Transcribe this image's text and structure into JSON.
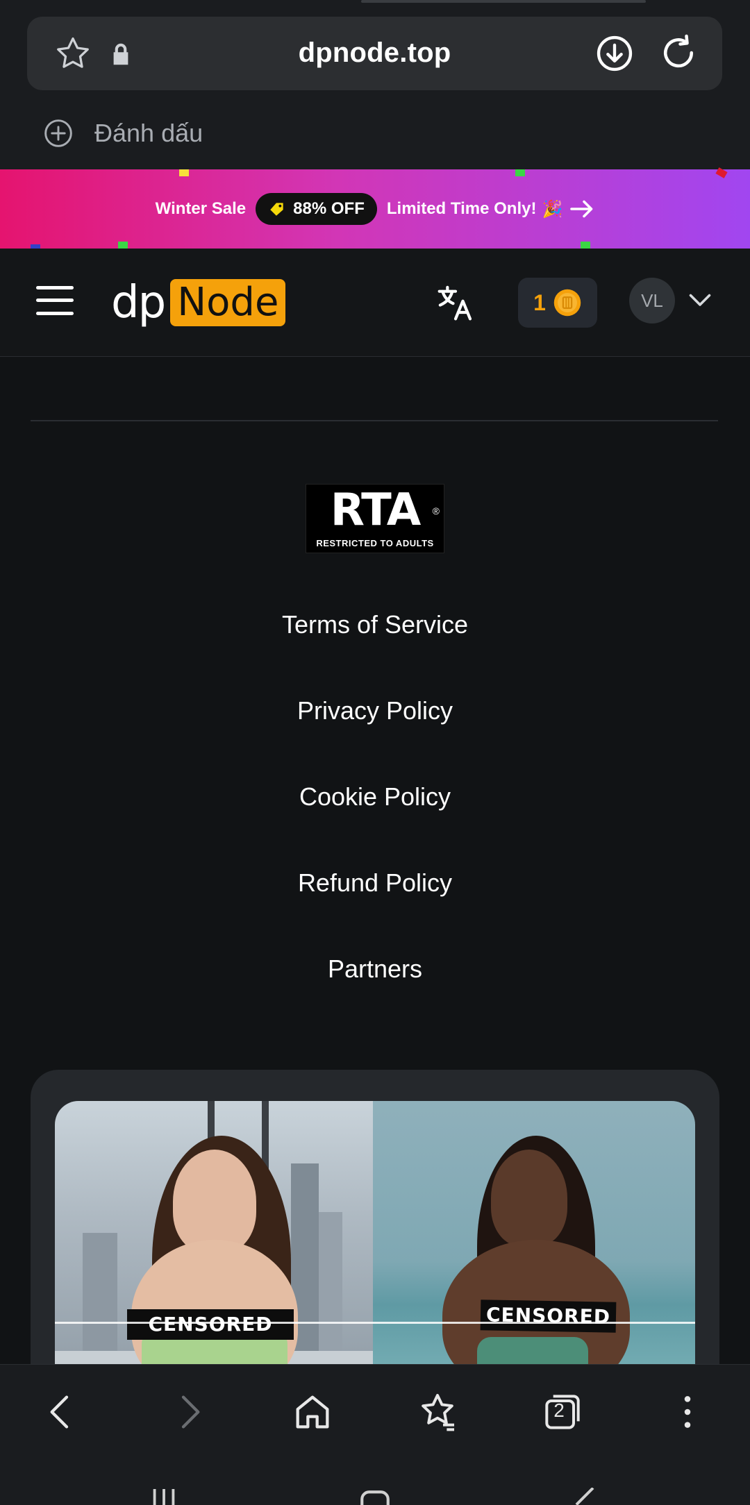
{
  "browser": {
    "url": "dpnode.top",
    "bookmark_label": "Đánh dấu"
  },
  "promo_banner": {
    "sale_label": "Winter Sale",
    "discount": "88% OFF",
    "message": "Limited Time Only!",
    "emoji": "🎉"
  },
  "header": {
    "logo_dp": "dp",
    "logo_node": "Node",
    "coins": "1",
    "avatar_initials": "VL"
  },
  "rta": {
    "title": "RTA",
    "registered": "®",
    "subtitle": "RESTRICTED TO ADULTS"
  },
  "footer": {
    "links": [
      "Terms of Service",
      "Privacy Policy",
      "Cookie Policy",
      "Refund Policy",
      "Partners"
    ]
  },
  "card": {
    "censor_left": "CENSORED",
    "censor_right": "CENSORED"
  },
  "nav": {
    "tabs_count": "2"
  },
  "colors": {
    "accent": "#f5a10b",
    "background": "#111315",
    "banner_start": "#e5146f",
    "banner_end": "#a146f0"
  },
  "icons": {
    "url_bar": [
      "star-icon",
      "lock-icon",
      "download-icon",
      "reload-icon"
    ],
    "bookmark": "plus-circle-icon",
    "header": [
      "hamburger-icon",
      "translate-icon",
      "coin-icon",
      "chevron-down-icon"
    ],
    "nav": [
      "back-icon",
      "forward-icon",
      "home-icon",
      "bookmarks-icon",
      "tabs-icon",
      "more-icon"
    ]
  }
}
